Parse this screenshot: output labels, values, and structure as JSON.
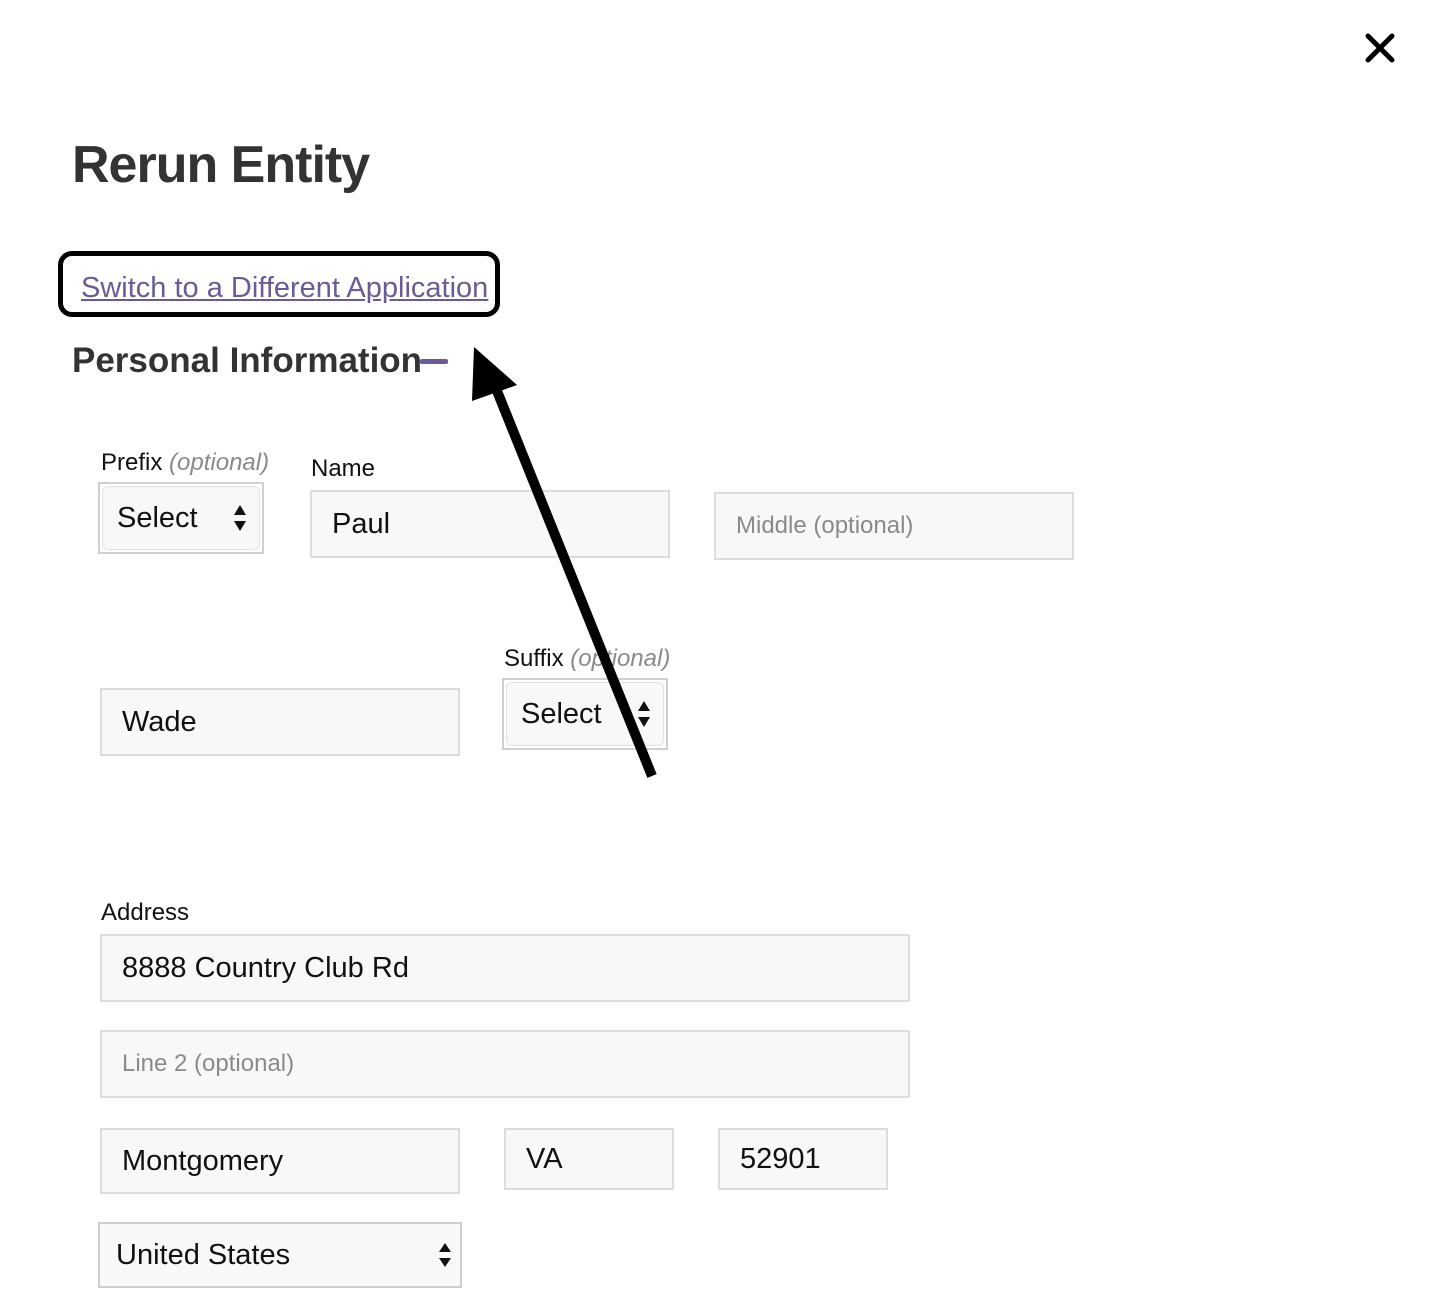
{
  "dialog": {
    "title": "Rerun Entity",
    "switch_link": "Switch to a Different Application"
  },
  "personal_info": {
    "title": "Personal Information",
    "prefix": {
      "label": "Prefix",
      "optional": "(optional)",
      "value": "Select"
    },
    "name": {
      "label": "Name",
      "first": "Paul",
      "middle_placeholder": "Middle (optional)",
      "last": "Wade"
    },
    "suffix": {
      "label": "Suffix",
      "optional": "(optional)",
      "value": "Select"
    }
  },
  "address": {
    "label": "Address",
    "line1": "8888 Country Club Rd",
    "line2_placeholder": "Line 2 (optional)",
    "city": "Montgomery",
    "state": "VA",
    "zip": "52901",
    "country": "United States"
  },
  "icons": {
    "close": "close-icon",
    "collapse": "minus-icon",
    "select": "up-down-arrows-icon",
    "annotation": "arrow-annotation"
  },
  "colors": {
    "accent": "#6b5b95",
    "title": "#333333",
    "field_bg": "#f8f8f8",
    "field_border": "#dcdcdc",
    "placeholder": "#8a8a8a"
  }
}
